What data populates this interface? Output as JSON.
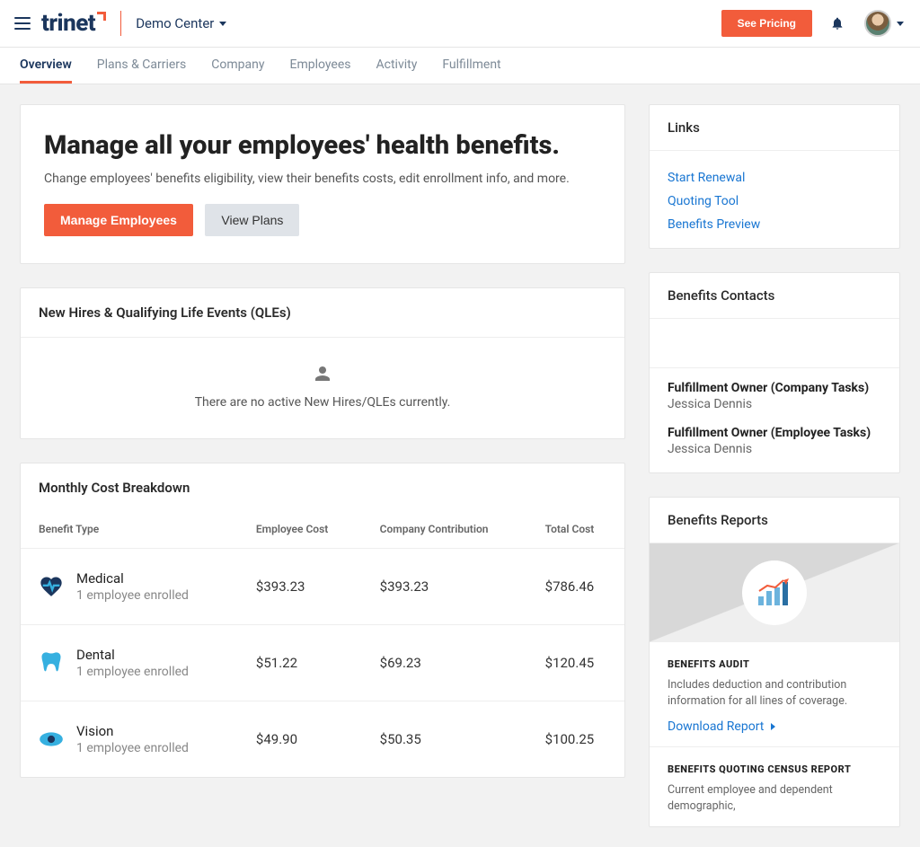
{
  "header": {
    "brand": "trinet",
    "workspace": "Demo Center",
    "pricing_button": "See Pricing"
  },
  "tabs": [
    {
      "label": "Overview",
      "active": true
    },
    {
      "label": "Plans & Carriers",
      "active": false
    },
    {
      "label": "Company",
      "active": false
    },
    {
      "label": "Employees",
      "active": false
    },
    {
      "label": "Activity",
      "active": false
    },
    {
      "label": "Fulfillment",
      "active": false
    }
  ],
  "hero": {
    "title": "Manage all your employees' health benefits.",
    "subtitle": "Change employees' benefits eligibility, view their benefits costs, edit enrollment info, and more.",
    "primary_button": "Manage Employees",
    "secondary_button": "View Plans"
  },
  "qle": {
    "title": "New Hires & Qualifying Life Events (QLEs)",
    "empty_message": "There are no active New Hires/QLEs currently."
  },
  "cost": {
    "title": "Monthly Cost Breakdown",
    "columns": {
      "benefit": "Benefit Type",
      "employee": "Employee Cost",
      "company": "Company Contribution",
      "total": "Total Cost"
    },
    "rows": [
      {
        "icon": "medical",
        "name": "Medical",
        "enrolled": "1 employee enrolled",
        "employee": "$393.23",
        "company": "$393.23",
        "total": "$786.46"
      },
      {
        "icon": "dental",
        "name": "Dental",
        "enrolled": "1 employee enrolled",
        "employee": "$51.22",
        "company": "$69.23",
        "total": "$120.45"
      },
      {
        "icon": "vision",
        "name": "Vision",
        "enrolled": "1 employee enrolled",
        "employee": "$49.90",
        "company": "$50.35",
        "total": "$100.25"
      }
    ]
  },
  "sidebar": {
    "links": {
      "title": "Links",
      "items": [
        "Start Renewal",
        "Quoting Tool",
        "Benefits Preview"
      ]
    },
    "contacts": {
      "title": "Benefits Contacts",
      "list": [
        {
          "role": "Fulfillment Owner (Company Tasks)",
          "name": "Jessica Dennis"
        },
        {
          "role": "Fulfillment Owner (Employee Tasks)",
          "name": "Jessica Dennis"
        }
      ]
    },
    "reports": {
      "title": "Benefits Reports",
      "items": [
        {
          "heading": "BENEFITS AUDIT",
          "desc": "Includes deduction and contribution information for all lines of coverage.",
          "link": "Download Report"
        },
        {
          "heading": "BENEFITS QUOTING CENSUS REPORT",
          "desc": "Current employee and dependent demographic,",
          "link": ""
        }
      ]
    }
  }
}
